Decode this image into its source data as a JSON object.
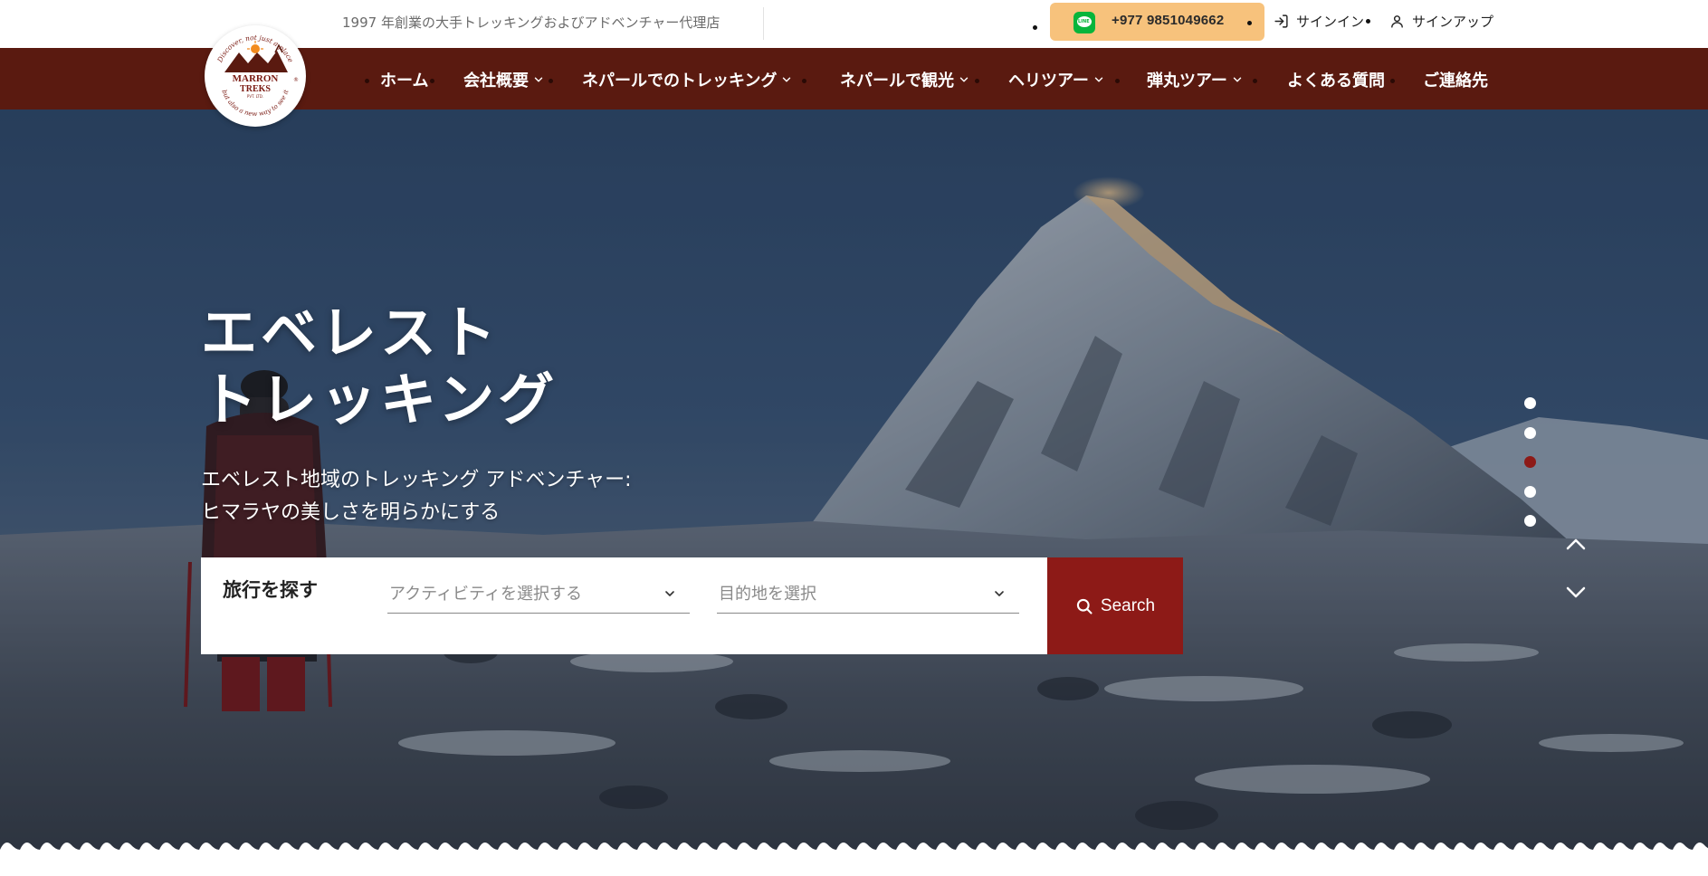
{
  "topbar": {
    "tagline": "1997 年創業の大手トレッキングおよびアドベンチャー代理店",
    "phone": "+977 9851049662",
    "line_icon": "line-app-icon",
    "signin_label": "サインイン",
    "signup_label": "サインアップ"
  },
  "logo": {
    "top_text": "Discover, not just a place",
    "brand_line1": "MARRON",
    "brand_line2": "TREKS",
    "brand_line3": "PVT. LTD.",
    "bottom_text": "but also a new way to see it",
    "registered": "®"
  },
  "nav": {
    "items": [
      {
        "label": "ホーム",
        "dropdown": false
      },
      {
        "label": "会社概要",
        "dropdown": true
      },
      {
        "label": "ネパールでのトレッキング",
        "dropdown": true
      },
      {
        "label": "ネパールで観光",
        "dropdown": true
      },
      {
        "label": "ヘリツアー",
        "dropdown": true
      },
      {
        "label": "弾丸ツアー",
        "dropdown": true
      },
      {
        "label": "よくある質問",
        "dropdown": false
      },
      {
        "label": "ご連絡先",
        "dropdown": false
      }
    ]
  },
  "hero": {
    "title_line1": "エベレスト",
    "title_line2": "トレッキング",
    "subtitle_line1": "エベレスト地域のトレッキング アドベンチャー:",
    "subtitle_line2": "ヒマラヤの美しさを明らかにする"
  },
  "search": {
    "label": "旅行を探す",
    "activity_placeholder": "アクティビティを選択する",
    "destination_placeholder": "目的地を選択",
    "button_label": "Search"
  },
  "slider": {
    "total": 5,
    "active_index": 2
  },
  "colors": {
    "nav_bg": "#5a1a10",
    "accent": "#8d1a17",
    "phone_pill": "#f7c27c",
    "line_green": "#07b53b"
  }
}
